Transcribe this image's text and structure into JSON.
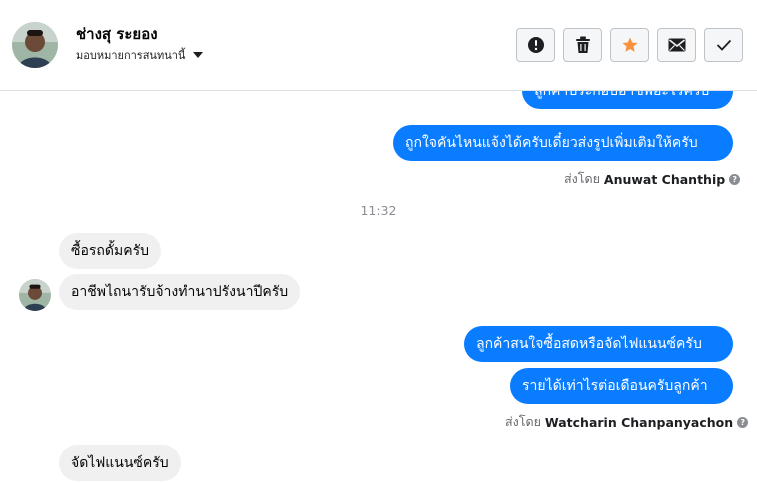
{
  "contact": {
    "name": "ช่างสุ ระยอง",
    "assign_label": "มอบหมายการสนทนานี้"
  },
  "actions": [
    {
      "name": "report-spam-button",
      "icon": "exclamation-circle-icon"
    },
    {
      "name": "delete-button",
      "icon": "trash-icon"
    },
    {
      "name": "star-button",
      "icon": "star-icon",
      "color": "#f7923b"
    },
    {
      "name": "mark-unread-button",
      "icon": "envelope-icon"
    },
    {
      "name": "mark-done-button",
      "icon": "check-icon"
    }
  ],
  "messages": {
    "m0": "ลูกค้าประกอบอาชีพอะไรครับ",
    "m1": "ถูกใจคันไหนแจ้งได้ครับเดี๋ยวส่งรูปเพิ่มเติมให้ครับ",
    "sender1_prefix": "ส่งโดย",
    "sender1_name": "Anuwat Chanthip",
    "time1": "11:32",
    "m2": "ซื้อรถดั้มครับ",
    "m3": "อาชีพไถนารับจ้างทำนาปรังนาปีครับ",
    "m4": "ลูกค้าสนใจซื้อสดหรือจัดไฟแนนซ์ครับ",
    "m5": "รายได้เท่าไรต่อเดือนครับลูกค้า",
    "sender2_prefix": "ส่งโดย",
    "sender2_name": "Watcharin Chanpanyachon",
    "m6": "จัดไฟแนนซ์ครับ"
  },
  "colors": {
    "outgoing_bubble": "#0a7cff",
    "incoming_bubble": "#f0f0f0"
  }
}
